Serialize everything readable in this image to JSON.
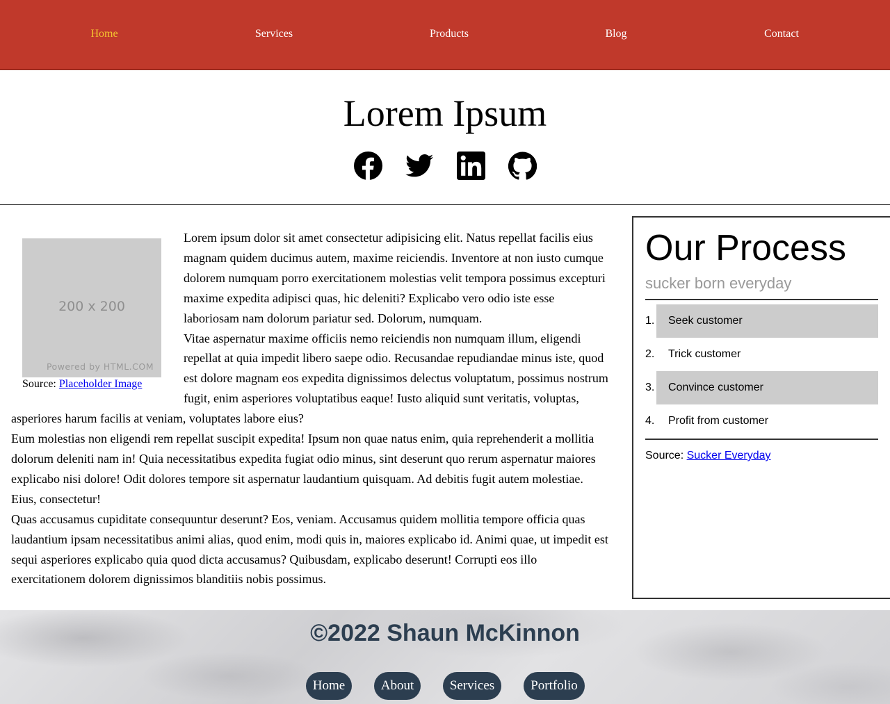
{
  "nav": {
    "items": [
      {
        "label": "Home",
        "active": true
      },
      {
        "label": "Services"
      },
      {
        "label": "Products"
      },
      {
        "label": "Blog"
      },
      {
        "label": "Contact"
      }
    ]
  },
  "header": {
    "title": "Lorem Ipsum",
    "social_icons": [
      "facebook-icon",
      "twitter-icon",
      "linkedin-icon",
      "github-icon"
    ]
  },
  "figure": {
    "placeholder_text": "200 x 200",
    "powered_text": "Powered by HTML.COM",
    "caption_prefix": "Source: ",
    "caption_link": "Placeholder Image"
  },
  "article": {
    "paragraphs": [
      "Lorem ipsum dolor sit amet consectetur adipisicing elit. Natus repellat facilis eius magnam quidem ducimus autem, maxime reiciendis. Inventore at non iusto cumque dolorem numquam porro exercitationem molestias velit tempora possimus excepturi maxime expedita adipisci quas, hic deleniti? Explicabo vero odio iste esse laboriosam nam dolorum pariatur sed. Dolorum, numquam.",
      "Vitae aspernatur maxime officiis nemo reiciendis non numquam illum, eligendi repellat at quia impedit libero saepe odio. Recusandae repudiandae minus iste, quod est dolore magnam eos expedita dignissimos delectus voluptatum, possimus nostrum fugit, enim asperiores voluptatibus eaque! Iusto aliquid sunt veritatis, voluptas, asperiores harum facilis at veniam, voluptates labore eius?",
      "Eum molestias non eligendi rem repellat suscipit expedita! Ipsum non quae natus enim, quia reprehenderit a mollitia dolorum deleniti nam in! Quia necessitatibus expedita fugiat odio minus, sint deserunt quo rerum aspernatur maiores explicabo nisi dolore! Odit dolores tempore sit aspernatur laudantium quisquam. Ad debitis fugit autem molestiae. Eius, consectetur!",
      "Quas accusamus cupiditate consequuntur deserunt? Eos, veniam. Accusamus quidem mollitia tempore officia quas laudantium ipsam necessitatibus animi alias, quod enim, modi quis in, maiores explicabo id. Animi quae, ut impedit est sequi asperiores explicabo quia quod dicta accusamus? Quibusdam, explicabo deserunt! Corrupti eos illo exercitationem dolorem dignissimos blanditiis nobis possimus."
    ]
  },
  "aside": {
    "title": "Our Process",
    "tagline": "sucker born everyday",
    "steps": [
      {
        "num": "1.",
        "label": "Seek customer",
        "shaded": true
      },
      {
        "num": "2.",
        "label": "Trick customer",
        "shaded": false
      },
      {
        "num": "3.",
        "label": "Convince customer",
        "shaded": true
      },
      {
        "num": "4.",
        "label": "Profit from customer",
        "shaded": false
      }
    ],
    "source_prefix": "Source: ",
    "source_link": "Sucker Everyday"
  },
  "footer": {
    "copyright": "©2022 Shaun McKinnon",
    "nav": [
      "Home",
      "About",
      "Services",
      "Portfolio"
    ]
  },
  "colors": {
    "nav_bg": "#c0392b",
    "nav_active": "#f4c430",
    "footer_pill": "#2c3e50",
    "link": "#0000ee"
  }
}
